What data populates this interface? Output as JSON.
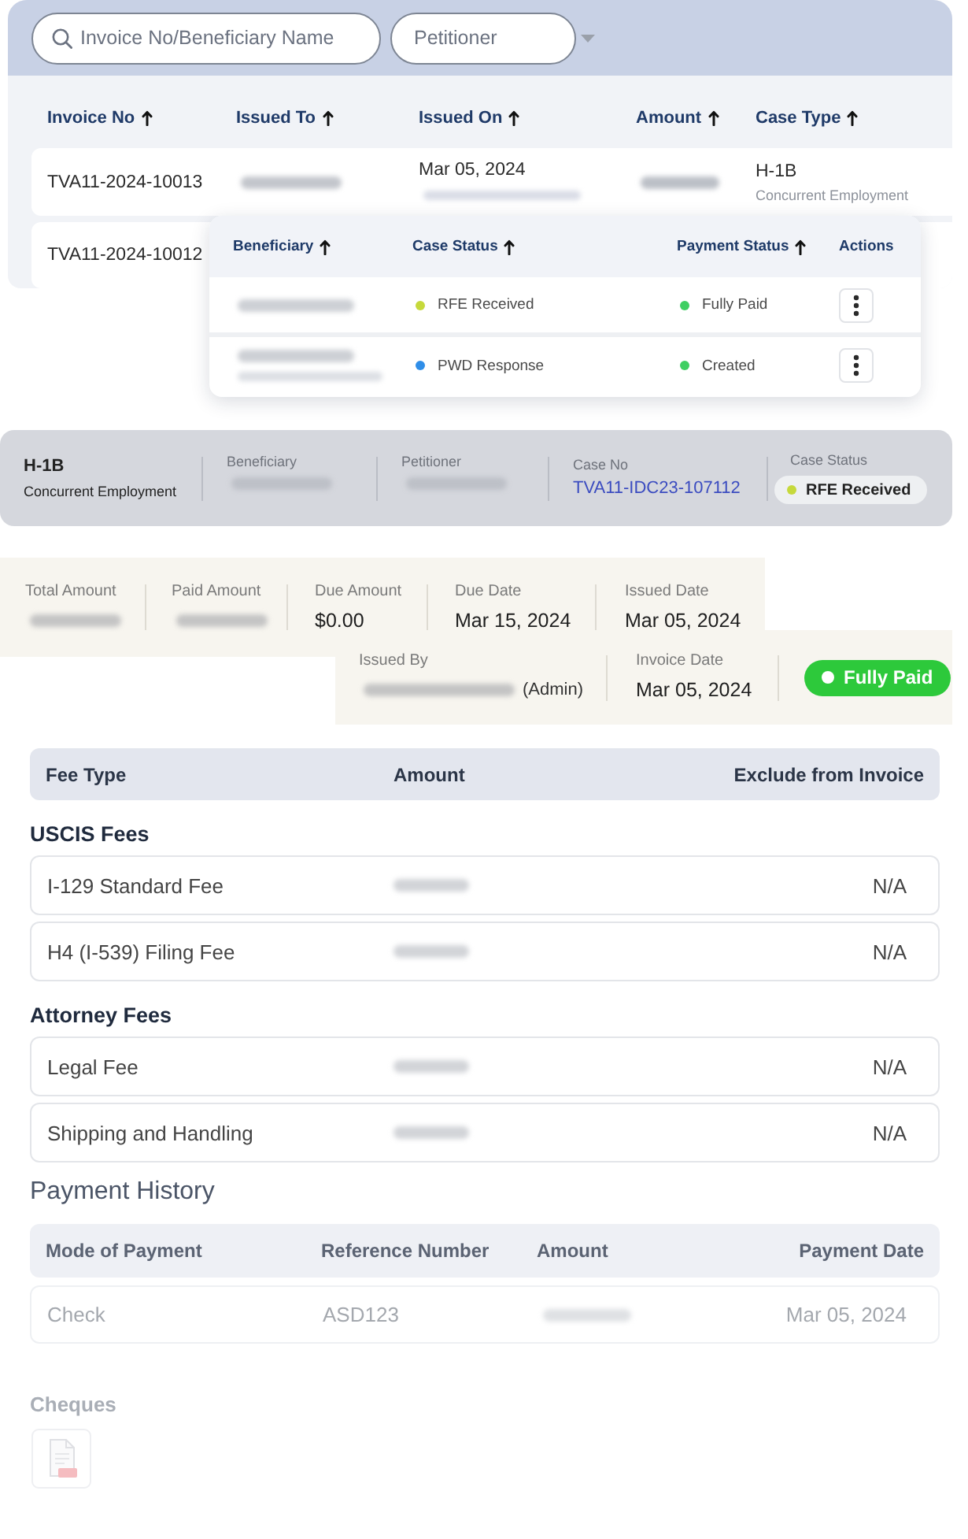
{
  "invoice_list": {
    "search": {
      "placeholder": "Invoice No/Beneficiary Name"
    },
    "petitioner_filter": {
      "placeholder": "Petitioner"
    },
    "columns": [
      {
        "label": "Invoice No",
        "sortable": true
      },
      {
        "label": "Issued To",
        "sortable": true
      },
      {
        "label": "Issued On",
        "sortable": true
      },
      {
        "label": "Amount",
        "sortable": true
      },
      {
        "label": "Case Type",
        "sortable": true
      }
    ],
    "rows": [
      {
        "invoice_no": "TVA11-2024-10013",
        "issued_to": {
          "kind": "blurred"
        },
        "issued_on": "Mar 05, 2024",
        "issued_by": {
          "kind": "blurred"
        },
        "amount": {
          "kind": "blurred"
        },
        "case_type": "H-1B",
        "case_subtype": "Concurrent Employment"
      },
      {
        "invoice_no": "TVA11-2024-10012"
      }
    ]
  },
  "status_popup": {
    "columns": [
      {
        "label": "Beneficiary",
        "sortable": true
      },
      {
        "label": "Case Status",
        "sortable": true
      },
      {
        "label": "Payment Status",
        "sortable": true
      },
      {
        "label": "Actions",
        "sortable": false
      }
    ],
    "rows": [
      {
        "beneficiary": [
          {
            "kind": "blurred"
          }
        ],
        "case_status": {
          "label": "RFE Received",
          "color": "#c6d93b"
        },
        "payment_status": {
          "label": "Fully Paid",
          "color": "#3fcf62"
        }
      },
      {
        "beneficiary": [
          {
            "kind": "blurred"
          },
          {
            "kind": "blurred"
          }
        ],
        "case_status": {
          "label": "PWD Response",
          "color": "#2f8ee8"
        },
        "payment_status": {
          "label": "Created",
          "color": "#3fcf62"
        }
      }
    ]
  },
  "case_summary": {
    "case_type": "H-1B",
    "case_subtype": "Concurrent Employment",
    "fields": [
      {
        "label": "Beneficiary",
        "value": {
          "kind": "blurred"
        },
        "link": false
      },
      {
        "label": "Petitioner",
        "value": {
          "kind": "blurred"
        },
        "link": false
      },
      {
        "label": "Case No",
        "value": "TVA11-IDC23-107112",
        "link": true
      }
    ],
    "case_status": {
      "label": "Case Status",
      "value": "RFE Received",
      "color": "#c6d93b"
    }
  },
  "invoice_summary": {
    "amounts": [
      {
        "label": "Total Amount",
        "value": {
          "kind": "blurred"
        }
      },
      {
        "label": "Paid Amount",
        "value": {
          "kind": "blurred"
        }
      },
      {
        "label": "Due Amount",
        "value": "$0.00"
      },
      {
        "label": "Due Date",
        "value": "Mar 15, 2024"
      },
      {
        "label": "Issued Date",
        "value": "Mar 05, 2024"
      }
    ],
    "details": [
      {
        "label": "Issued By",
        "value": {
          "kind": "blurred"
        },
        "role": "(Admin)"
      },
      {
        "label": "Invoice Date",
        "value": "Mar 05, 2024"
      }
    ],
    "payment_status": "Fully Paid"
  },
  "fees": {
    "columns": [
      "Fee Type",
      "Amount",
      "Exclude from Invoice"
    ],
    "groups": [
      {
        "title": "USCIS Fees",
        "rows": [
          {
            "fee_type": "I-129 Standard Fee",
            "amount": {
              "kind": "blurred"
            },
            "exclude": "N/A"
          },
          {
            "fee_type": "H4 (I-539) Filing Fee",
            "amount": {
              "kind": "blurred"
            },
            "exclude": "N/A"
          }
        ]
      },
      {
        "title": "Attorney Fees",
        "rows": [
          {
            "fee_type": "Legal Fee",
            "amount": {
              "kind": "blurred"
            },
            "exclude": "N/A"
          },
          {
            "fee_type": "Shipping and Handling",
            "amount": {
              "kind": "blurred"
            },
            "exclude": "N/A"
          }
        ]
      }
    ]
  },
  "payment_history": {
    "title": "Payment History",
    "columns": [
      "Mode of Payment",
      "Reference Number",
      "Amount",
      "Payment Date"
    ],
    "rows": [
      {
        "mode": "Check",
        "reference": "ASD123",
        "amount": {
          "kind": "blurred"
        },
        "date": "Mar 05, 2024"
      }
    ]
  },
  "cheques": {
    "title": "Cheques",
    "files": [
      {
        "kind": "pdf"
      }
    ]
  }
}
